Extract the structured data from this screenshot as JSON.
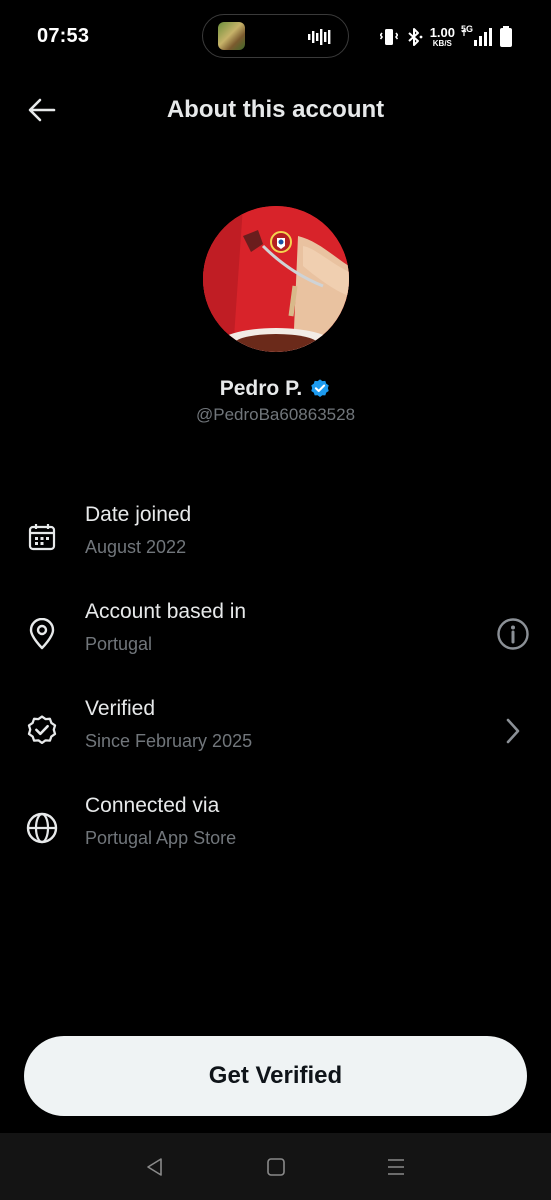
{
  "status_bar": {
    "time": "07:53",
    "speed_value": "1.00",
    "speed_unit": "KB/S",
    "network": "5G"
  },
  "header": {
    "title": "About this account",
    "back_icon": "arrow-left-icon"
  },
  "profile": {
    "name": "Pedro P.",
    "handle": "@PedroBa60863528",
    "verified_color": "#1d9bf0"
  },
  "info": [
    {
      "label": "Date joined",
      "value": "August 2022",
      "icon": "calendar-icon"
    },
    {
      "label": "Account based in",
      "value": "Portugal",
      "icon": "location-pin-icon",
      "action_icon": "info-icon"
    },
    {
      "label": "Verified",
      "value": "Since February 2025",
      "icon": "verified-badge-icon",
      "action_icon": "chevron-right-icon"
    },
    {
      "label": "Connected via",
      "value": "Portugal App Store",
      "icon": "globe-icon"
    }
  ],
  "cta": {
    "label": "Get Verified"
  },
  "colors": {
    "background": "#000000",
    "primary_text": "#e7e9ea",
    "secondary_text": "#71767b",
    "button_bg": "#eff3f4",
    "button_text": "#0f1419",
    "accent": "#1d9bf0"
  }
}
